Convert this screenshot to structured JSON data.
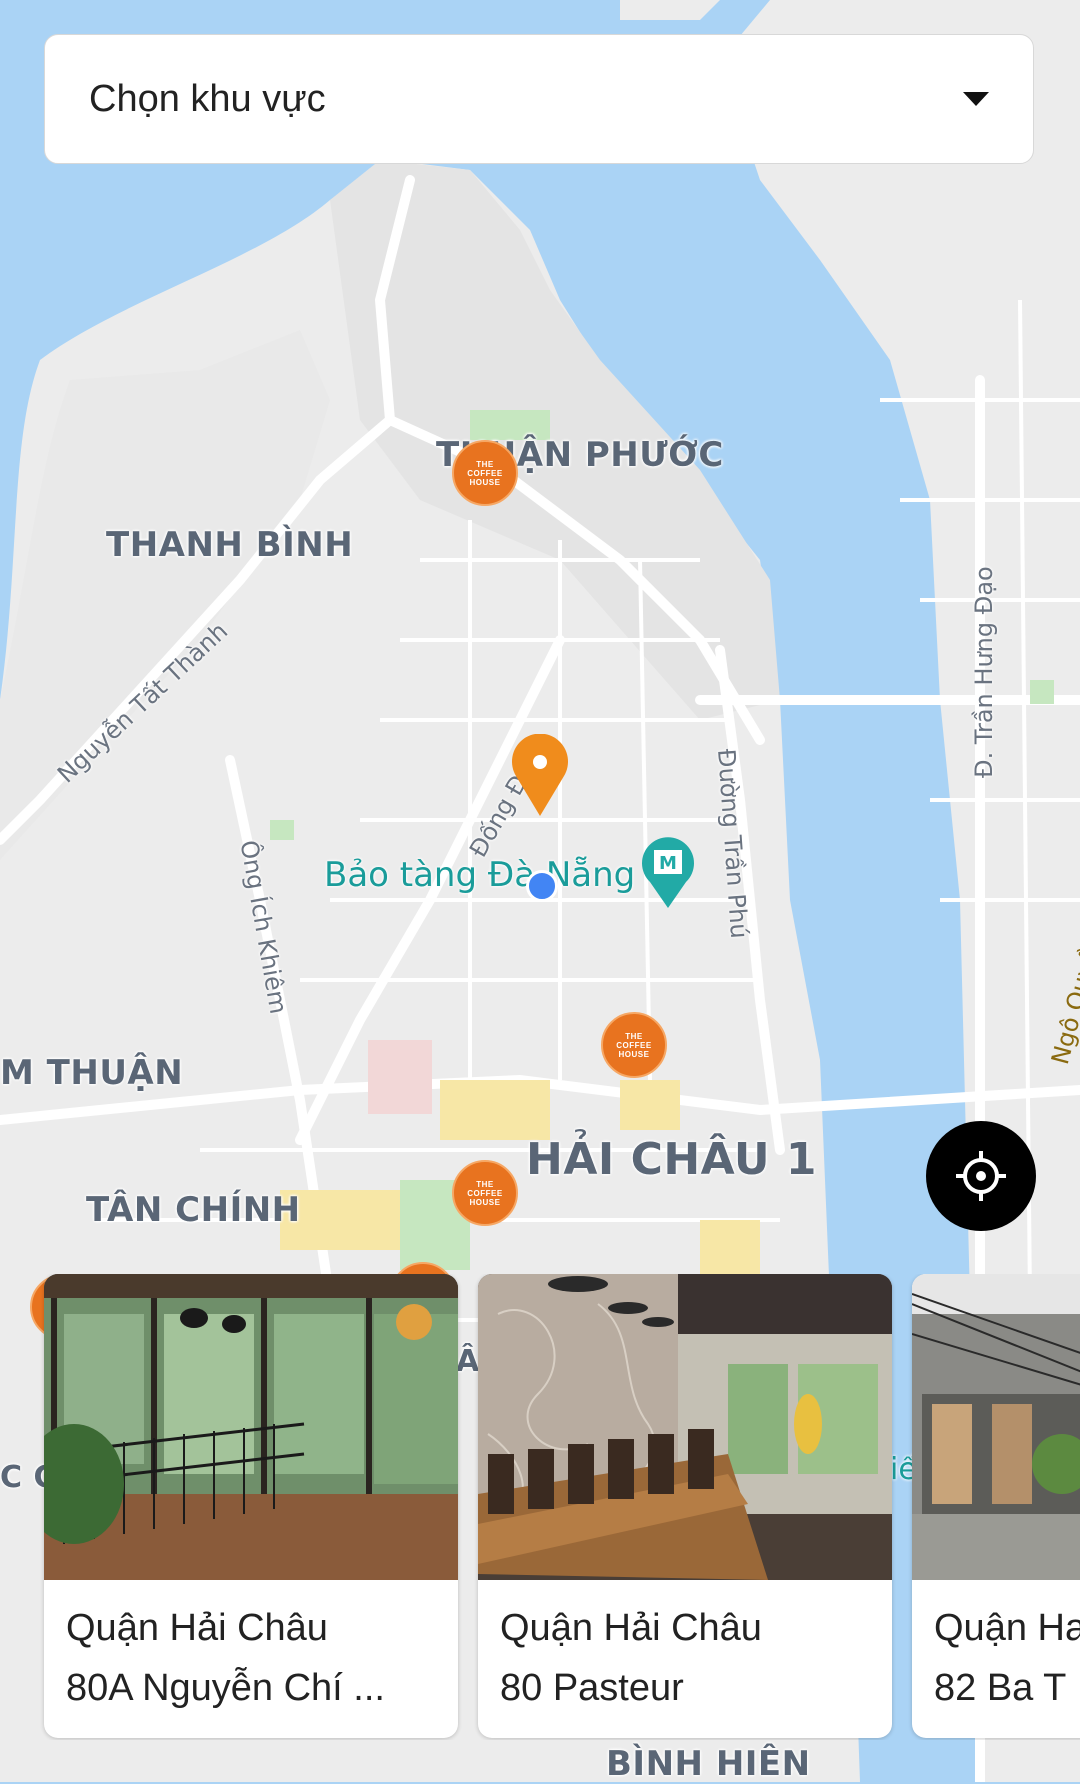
{
  "region_select": {
    "placeholder": "Chọn khu vực"
  },
  "map": {
    "districts": [
      "THUẬN PHƯỚC",
      "THANH BÌNH",
      "M THUẬN",
      "HẢI CHÂU 1",
      "TÂN CHÍNH",
      "BÌNH HIÊN"
    ],
    "streets": [
      "Nguyễn Tất Thành",
      "Ông Ích Khiêm",
      "Đống Đa",
      "Đường Trần Phú",
      "Đ. Trần Hưng Đạo",
      "Ngô Quyền"
    ],
    "poi": "Bảo tàng Đà Nẵng",
    "fragments": [
      "C G",
      "iế",
      "ầ",
      "n",
      "Â"
    ]
  },
  "store_logo": [
    "THE",
    "COFFEE",
    "HOUSE"
  ],
  "stores": [
    {
      "district": "Quận Hải Châu",
      "address": "80A Nguyễn Chí ..."
    },
    {
      "district": "Quận Hải Châu",
      "address": "80 Pasteur"
    },
    {
      "district": "Quận Ha",
      "address": "82 Ba T"
    }
  ]
}
